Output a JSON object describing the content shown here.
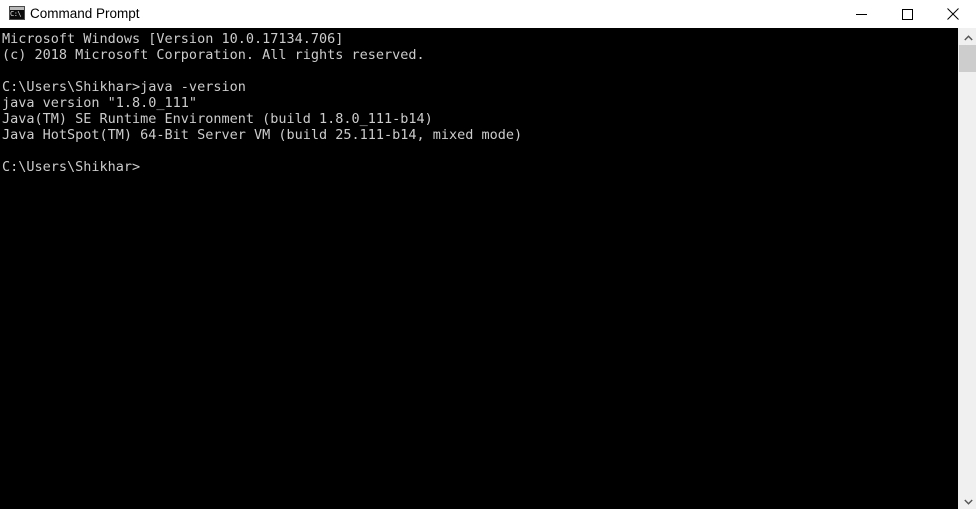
{
  "window": {
    "title": "Command Prompt",
    "icon": "command-prompt-icon",
    "icon_text": "C:\\",
    "background_color": "#000000",
    "titlebar_color": "#ffffff",
    "text_color": "#cccccc"
  },
  "window_controls": {
    "minimize": "minimize-icon",
    "maximize": "maximize-icon",
    "close": "close-icon"
  },
  "console": {
    "lines": [
      "Microsoft Windows [Version 10.0.17134.706]",
      "(c) 2018 Microsoft Corporation. All rights reserved.",
      "",
      "C:\\Users\\Shikhar>java -version",
      "java version \"1.8.0_111\"",
      "Java(TM) SE Runtime Environment (build 1.8.0_111-b14)",
      "Java HotSpot(TM) 64-Bit Server VM (build 25.111-b14, mixed mode)",
      "",
      "C:\\Users\\Shikhar>"
    ],
    "text": "Microsoft Windows [Version 10.0.17134.706]\n(c) 2018 Microsoft Corporation. All rights reserved.\n\nC:\\Users\\Shikhar>java -version\njava version \"1.8.0_111\"\nJava(TM) SE Runtime Environment (build 1.8.0_111-b14)\nJava HotSpot(TM) 64-Bit Server VM (build 25.111-b14, mixed mode)\n\nC:\\Users\\Shikhar>",
    "prompt": "C:\\Users\\Shikhar>",
    "command": "java -version"
  },
  "scrollbar": {
    "up_arrow": "chevron-up-icon",
    "down_arrow": "chevron-down-icon",
    "track_color": "#f0f0f0",
    "thumb_color": "#cdcdcd"
  }
}
